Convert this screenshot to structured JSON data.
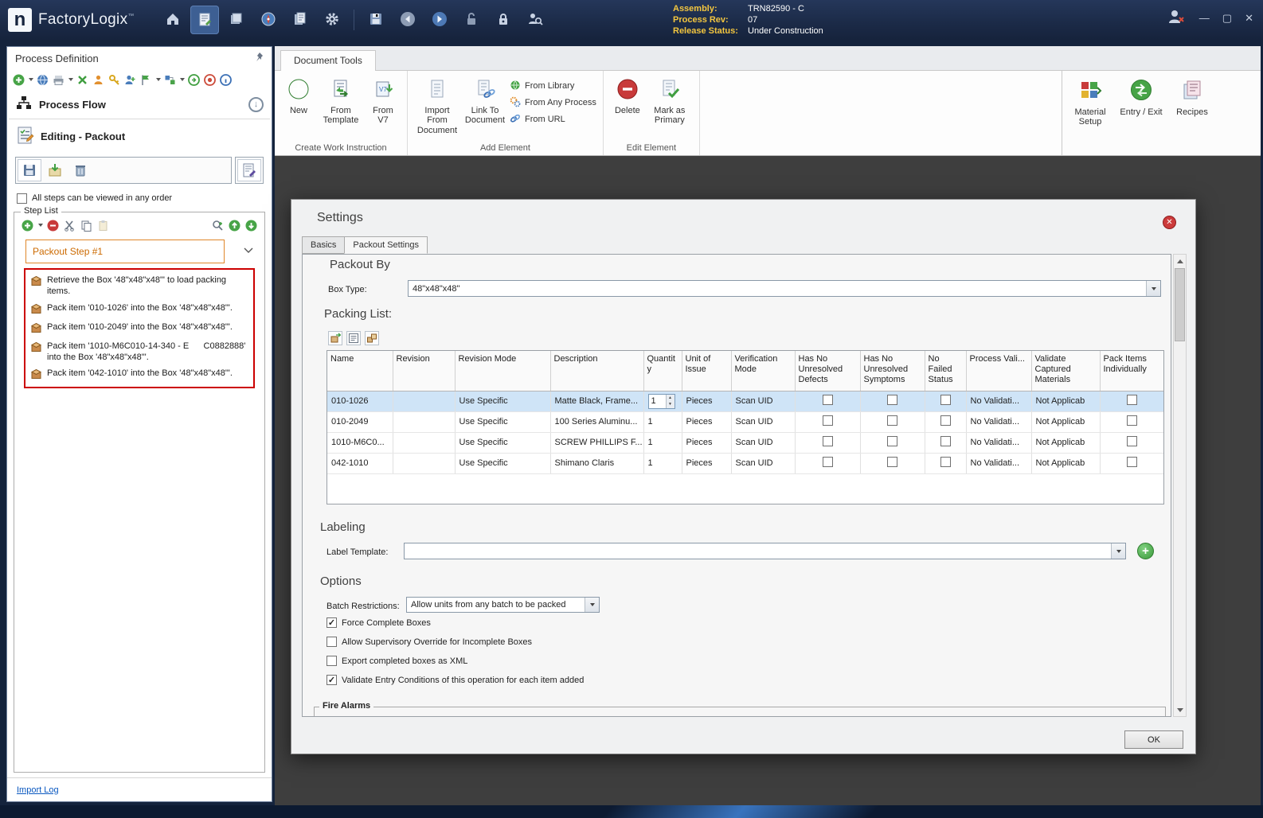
{
  "titlebar": {
    "app_name": "FactoryLogix",
    "trademark": "™",
    "assembly": {
      "label": "Assembly:",
      "value": "TRN82590 - C"
    },
    "process_rev": {
      "label": "Process Rev:",
      "value": "07"
    },
    "release_status": {
      "label": "Release Status:",
      "value": "Under Construction"
    }
  },
  "left_panel": {
    "title": "Process Definition",
    "process_flow": "Process Flow",
    "editing": "Editing - Packout",
    "order_checkbox": "All steps can be viewed in any order",
    "step_list_title": "Step List",
    "selected_step": "Packout Step #1",
    "steps": [
      "Retrieve the Box '48\"x48\"x48\"' to load packing items.",
      "Pack item '010-1026' into the Box '48\"x48\"x48\"'.",
      "Pack item '010-2049' into the Box '48\"x48\"x48\"'.",
      "Pack item '1010-M6C010-14-340 - E      C0882888' into the Box '48\"x48\"x48\"'.",
      "Pack item '042-1010' into the Box '48\"x48\"x48\"'."
    ],
    "import_log": "Import Log"
  },
  "ribbon": {
    "tab": "Document Tools",
    "create_group": {
      "label": "Create Work Instruction",
      "new": "New",
      "from_template": "From Template",
      "from_v7": "From V7"
    },
    "add_group": {
      "label": "Add Element",
      "import_from_document": "Import From Document",
      "link_to_document": "Link To Document",
      "from_library": "From Library",
      "from_any_process": "From Any Process",
      "from_url": "From URL"
    },
    "edit_group": {
      "label": "Edit Element",
      "delete": "Delete",
      "mark_as_primary": "Mark as Primary"
    },
    "right_buttons": {
      "material_setup": "Material Setup",
      "entry_exit": "Entry / Exit",
      "recipes": "Recipes"
    }
  },
  "dialog": {
    "title": "Settings",
    "tabs": [
      "Basics",
      "Packout Settings"
    ],
    "packout_by": "Packout By",
    "box_type_label": "Box Type:",
    "box_type_value": "48\"x48\"x48\"",
    "packing_list_title": "Packing List:",
    "table": {
      "columns": [
        "Name",
        "Revision",
        "Revision Mode",
        "Description",
        "Quantity",
        "Unit of Issue",
        "Verification Mode",
        "Has No Unresolved Defects",
        "Has No Unresolved Symptoms",
        "No Failed Status",
        "Process Vali...",
        "Validate Captured Materials",
        "Pack Items Individually"
      ],
      "rows": [
        {
          "name": "010-1026",
          "revision": "",
          "revision_mode": "Use Specific",
          "description": "Matte Black, Frame...",
          "quantity": "1",
          "unit_of_issue": "Pieces",
          "verification_mode": "Scan UID",
          "has_no_unresolved_defects": false,
          "has_no_unresolved_symptoms": false,
          "no_failed_status": false,
          "process_validation": "No Validati...",
          "validate_captured_materials": "Not Applicab",
          "pack_items_individually": false,
          "selected": true
        },
        {
          "name": "010-2049",
          "revision": "",
          "revision_mode": "Use Specific",
          "description": "100 Series Aluminu...",
          "quantity": "1",
          "unit_of_issue": "Pieces",
          "verification_mode": "Scan UID",
          "has_no_unresolved_defects": false,
          "has_no_unresolved_symptoms": false,
          "no_failed_status": false,
          "process_validation": "No Validati...",
          "validate_captured_materials": "Not Applicab",
          "pack_items_individually": false,
          "selected": false
        },
        {
          "name": "1010-M6C0...",
          "revision": "",
          "revision_mode": "Use Specific",
          "description": "SCREW PHILLIPS F...",
          "quantity": "1",
          "unit_of_issue": "Pieces",
          "verification_mode": "Scan UID",
          "has_no_unresolved_defects": false,
          "has_no_unresolved_symptoms": false,
          "no_failed_status": false,
          "process_validation": "No Validati...",
          "validate_captured_materials": "Not Applicab",
          "pack_items_individually": false,
          "selected": false
        },
        {
          "name": "042-1010",
          "revision": "",
          "revision_mode": "Use Specific",
          "description": "Shimano Claris",
          "quantity": "1",
          "unit_of_issue": "Pieces",
          "verification_mode": "Scan UID",
          "has_no_unresolved_defects": false,
          "has_no_unresolved_symptoms": false,
          "no_failed_status": false,
          "process_validation": "No Validati...",
          "validate_captured_materials": "Not Applicab",
          "pack_items_individually": false,
          "selected": false
        }
      ]
    },
    "labeling_title": "Labeling",
    "label_template_label": "Label Template:",
    "label_template_value": "",
    "options_title": "Options",
    "batch_restrictions_label": "Batch Restrictions:",
    "batch_restrictions_value": "Allow units from any batch to be packed",
    "option_checkboxes": [
      {
        "label": "Force Complete Boxes",
        "checked": true
      },
      {
        "label": "Allow Supervisory Override for Incomplete Boxes",
        "checked": false
      },
      {
        "label": "Export completed boxes as XML",
        "checked": false
      },
      {
        "label": "Validate Entry Conditions of this operation for each item added",
        "checked": true
      }
    ],
    "fire_alarms_title": "Fire Alarms",
    "ok_button": "OK"
  }
}
